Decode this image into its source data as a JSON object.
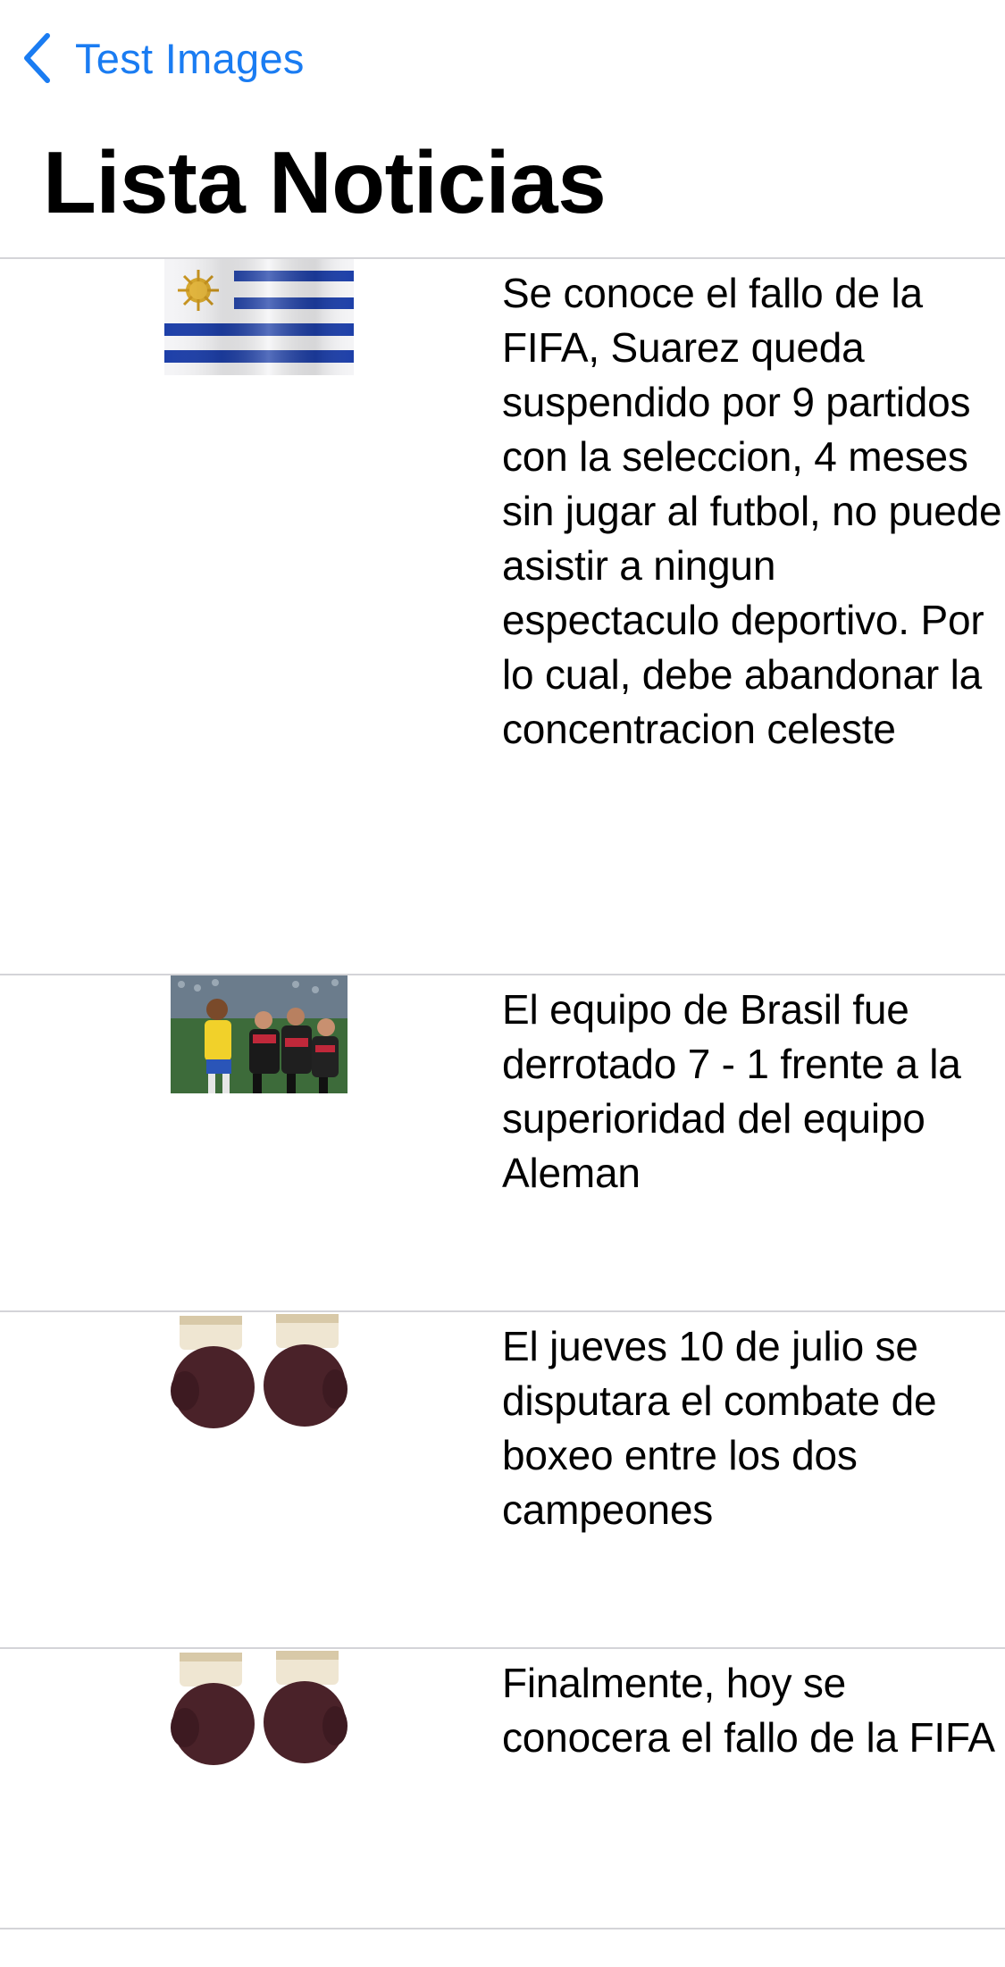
{
  "nav": {
    "back_label": "Test Images",
    "accent_color": "#1a7cf2",
    "back_icon": "chevron-left-icon"
  },
  "page": {
    "title": "Lista Noticias"
  },
  "news": [
    {
      "image": "uruguay-flag",
      "text": "Se conoce el fallo de la FIFA, Suarez queda suspendido por 9 partidos con la seleccion, 4 meses sin jugar al futbol, no puede asistir a ningun espectaculo deportivo. Por lo cual, debe abandonar la concentracion celeste"
    },
    {
      "image": "brazil-germany-match-photo",
      "text": "El equipo de Brasil fue derrotado 7 - 1 frente a la superioridad del equipo Aleman"
    },
    {
      "image": "boxing-gloves",
      "text": "El jueves 10 de julio se disputara el combate de boxeo entre los dos campeones"
    },
    {
      "image": "boxing-gloves",
      "text": "Finalmente, hoy se conocera el fallo de la FIFA"
    }
  ]
}
